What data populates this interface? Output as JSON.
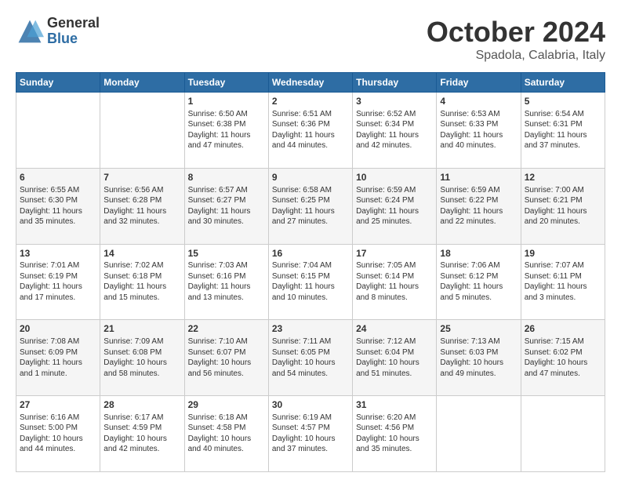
{
  "header": {
    "logo": {
      "general": "General",
      "blue": "Blue"
    },
    "title": "October 2024",
    "location": "Spadola, Calabria, Italy"
  },
  "columns": [
    "Sunday",
    "Monday",
    "Tuesday",
    "Wednesday",
    "Thursday",
    "Friday",
    "Saturday"
  ],
  "weeks": [
    [
      {
        "day": "",
        "info": ""
      },
      {
        "day": "",
        "info": ""
      },
      {
        "day": "1",
        "info": "Sunrise: 6:50 AM\nSunset: 6:38 PM\nDaylight: 11 hours and 47 minutes."
      },
      {
        "day": "2",
        "info": "Sunrise: 6:51 AM\nSunset: 6:36 PM\nDaylight: 11 hours and 44 minutes."
      },
      {
        "day": "3",
        "info": "Sunrise: 6:52 AM\nSunset: 6:34 PM\nDaylight: 11 hours and 42 minutes."
      },
      {
        "day": "4",
        "info": "Sunrise: 6:53 AM\nSunset: 6:33 PM\nDaylight: 11 hours and 40 minutes."
      },
      {
        "day": "5",
        "info": "Sunrise: 6:54 AM\nSunset: 6:31 PM\nDaylight: 11 hours and 37 minutes."
      }
    ],
    [
      {
        "day": "6",
        "info": "Sunrise: 6:55 AM\nSunset: 6:30 PM\nDaylight: 11 hours and 35 minutes."
      },
      {
        "day": "7",
        "info": "Sunrise: 6:56 AM\nSunset: 6:28 PM\nDaylight: 11 hours and 32 minutes."
      },
      {
        "day": "8",
        "info": "Sunrise: 6:57 AM\nSunset: 6:27 PM\nDaylight: 11 hours and 30 minutes."
      },
      {
        "day": "9",
        "info": "Sunrise: 6:58 AM\nSunset: 6:25 PM\nDaylight: 11 hours and 27 minutes."
      },
      {
        "day": "10",
        "info": "Sunrise: 6:59 AM\nSunset: 6:24 PM\nDaylight: 11 hours and 25 minutes."
      },
      {
        "day": "11",
        "info": "Sunrise: 6:59 AM\nSunset: 6:22 PM\nDaylight: 11 hours and 22 minutes."
      },
      {
        "day": "12",
        "info": "Sunrise: 7:00 AM\nSunset: 6:21 PM\nDaylight: 11 hours and 20 minutes."
      }
    ],
    [
      {
        "day": "13",
        "info": "Sunrise: 7:01 AM\nSunset: 6:19 PM\nDaylight: 11 hours and 17 minutes."
      },
      {
        "day": "14",
        "info": "Sunrise: 7:02 AM\nSunset: 6:18 PM\nDaylight: 11 hours and 15 minutes."
      },
      {
        "day": "15",
        "info": "Sunrise: 7:03 AM\nSunset: 6:16 PM\nDaylight: 11 hours and 13 minutes."
      },
      {
        "day": "16",
        "info": "Sunrise: 7:04 AM\nSunset: 6:15 PM\nDaylight: 11 hours and 10 minutes."
      },
      {
        "day": "17",
        "info": "Sunrise: 7:05 AM\nSunset: 6:14 PM\nDaylight: 11 hours and 8 minutes."
      },
      {
        "day": "18",
        "info": "Sunrise: 7:06 AM\nSunset: 6:12 PM\nDaylight: 11 hours and 5 minutes."
      },
      {
        "day": "19",
        "info": "Sunrise: 7:07 AM\nSunset: 6:11 PM\nDaylight: 11 hours and 3 minutes."
      }
    ],
    [
      {
        "day": "20",
        "info": "Sunrise: 7:08 AM\nSunset: 6:09 PM\nDaylight: 11 hours and 1 minute."
      },
      {
        "day": "21",
        "info": "Sunrise: 7:09 AM\nSunset: 6:08 PM\nDaylight: 10 hours and 58 minutes."
      },
      {
        "day": "22",
        "info": "Sunrise: 7:10 AM\nSunset: 6:07 PM\nDaylight: 10 hours and 56 minutes."
      },
      {
        "day": "23",
        "info": "Sunrise: 7:11 AM\nSunset: 6:05 PM\nDaylight: 10 hours and 54 minutes."
      },
      {
        "day": "24",
        "info": "Sunrise: 7:12 AM\nSunset: 6:04 PM\nDaylight: 10 hours and 51 minutes."
      },
      {
        "day": "25",
        "info": "Sunrise: 7:13 AM\nSunset: 6:03 PM\nDaylight: 10 hours and 49 minutes."
      },
      {
        "day": "26",
        "info": "Sunrise: 7:15 AM\nSunset: 6:02 PM\nDaylight: 10 hours and 47 minutes."
      }
    ],
    [
      {
        "day": "27",
        "info": "Sunrise: 6:16 AM\nSunset: 5:00 PM\nDaylight: 10 hours and 44 minutes."
      },
      {
        "day": "28",
        "info": "Sunrise: 6:17 AM\nSunset: 4:59 PM\nDaylight: 10 hours and 42 minutes."
      },
      {
        "day": "29",
        "info": "Sunrise: 6:18 AM\nSunset: 4:58 PM\nDaylight: 10 hours and 40 minutes."
      },
      {
        "day": "30",
        "info": "Sunrise: 6:19 AM\nSunset: 4:57 PM\nDaylight: 10 hours and 37 minutes."
      },
      {
        "day": "31",
        "info": "Sunrise: 6:20 AM\nSunset: 4:56 PM\nDaylight: 10 hours and 35 minutes."
      },
      {
        "day": "",
        "info": ""
      },
      {
        "day": "",
        "info": ""
      }
    ]
  ]
}
